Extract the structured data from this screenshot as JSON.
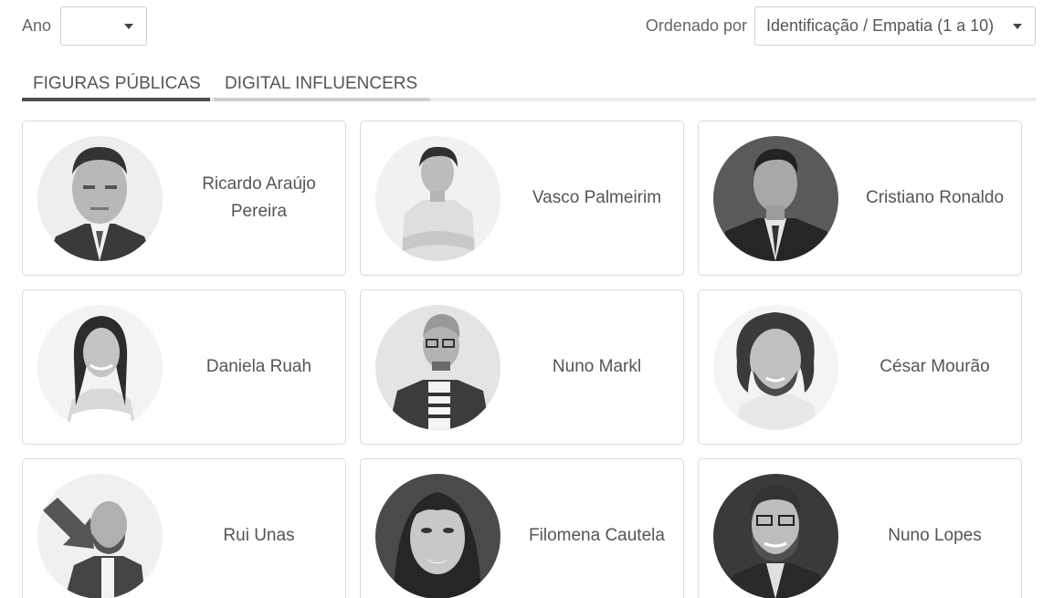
{
  "filters": {
    "year_label": "Ano",
    "year_value": "",
    "sort_label": "Ordenado por",
    "sort_value": "Identificação / Empatia (1 a 10)",
    "caret_icon": "caret-down-icon"
  },
  "tabs": [
    {
      "label": "FIGURAS PÚBLICAS",
      "active": true
    },
    {
      "label": "DIGITAL INFLUENCERS",
      "active": false
    }
  ],
  "people": [
    {
      "name": "Ricardo Araújo Pereira"
    },
    {
      "name": "Vasco Palmeirim"
    },
    {
      "name": "Cristiano Ronaldo"
    },
    {
      "name": "Daniela Ruah"
    },
    {
      "name": "Nuno Markl"
    },
    {
      "name": "César Mourão"
    },
    {
      "name": "Rui Unas"
    },
    {
      "name": "Filomena Cautela"
    },
    {
      "name": "Nuno Lopes"
    }
  ],
  "colors": {
    "tab_active": "#4d4d4d",
    "tab_inactive": "#cfcfcf",
    "card_border": "#d9d9d9",
    "text": "#555555"
  }
}
